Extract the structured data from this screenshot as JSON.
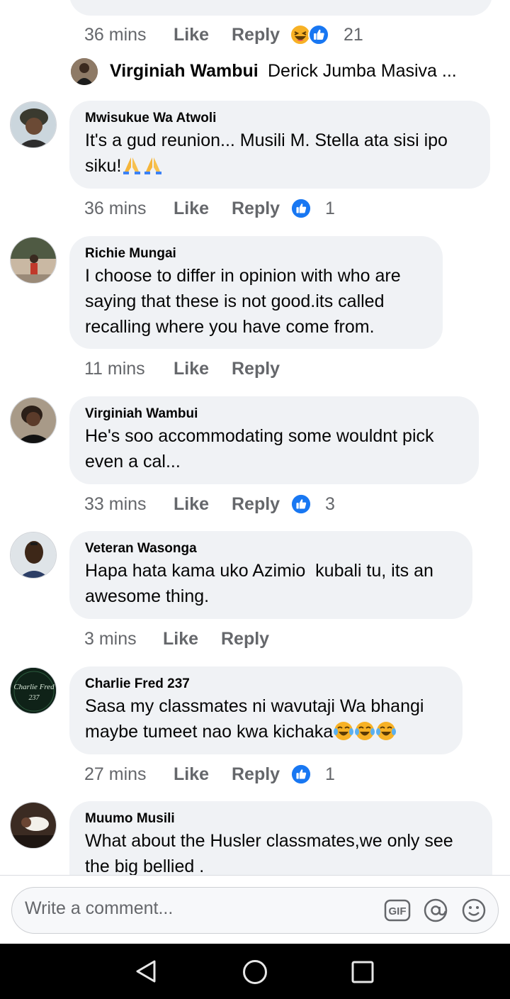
{
  "top_reply": {
    "time": "36 mins",
    "like": "Like",
    "reply": "Reply",
    "reaction_count": "21"
  },
  "reply_preview": {
    "author": "Virginiah Wambui",
    "text": "Derick Jumba Masiva ..."
  },
  "comments": [
    {
      "author": "Mwisukue Wa Atwoli",
      "text": "It's a gud reunion... Musili M. Stella ata sisi ipo siku!",
      "time": "36 mins",
      "like": "Like",
      "reply": "Reply",
      "reaction_count": "1"
    },
    {
      "author": "Richie Mungai",
      "text": "I choose to differ in opinion with who are saying that these is not good.its called recalling where you have come from.",
      "time": "11 mins",
      "like": "Like",
      "reply": "Reply",
      "reaction_count": ""
    },
    {
      "author": "Virginiah Wambui",
      "text": "He's soo accommodating some wouldnt pick even a cal...",
      "time": "33 mins",
      "like": "Like",
      "reply": "Reply",
      "reaction_count": "3"
    },
    {
      "author": "Veteran Wasonga",
      "text": "Hapa hata kama uko Azimio  kubali tu, its an awesome thing.",
      "time": "3 mins",
      "like": "Like",
      "reply": "Reply",
      "reaction_count": ""
    },
    {
      "author": "Charlie Fred 237",
      "text": "Sasa my classmates ni wavutaji Wa bhangi maybe tumeet nao kwa kichaka",
      "time": "27 mins",
      "like": "Like",
      "reply": "Reply",
      "reaction_count": "1"
    },
    {
      "author": "Muumo Musili",
      "text": "What about the Husler classmates,we only see the big bellied .",
      "time": "",
      "like": "",
      "reply": "",
      "reaction_count": ""
    }
  ],
  "avatar_text": {
    "charlie": "Charlie Fred",
    "charlie_num": "237"
  },
  "composer": {
    "placeholder": "Write a comment...",
    "gif_label": "GIF"
  },
  "icons": {
    "like": "thumbs-up-icon",
    "haha": "laughing-emoji-icon",
    "pray": "folded-hands-emoji-icon",
    "tears": "tears-of-joy-emoji-icon",
    "mention": "at-icon",
    "emoji": "smiley-icon",
    "back": "back-icon",
    "home": "home-icon",
    "recents": "recents-icon"
  },
  "colors": {
    "like_blue": "#1877f2",
    "bubble": "#f0f2f5",
    "meta_gray": "#65676b"
  }
}
